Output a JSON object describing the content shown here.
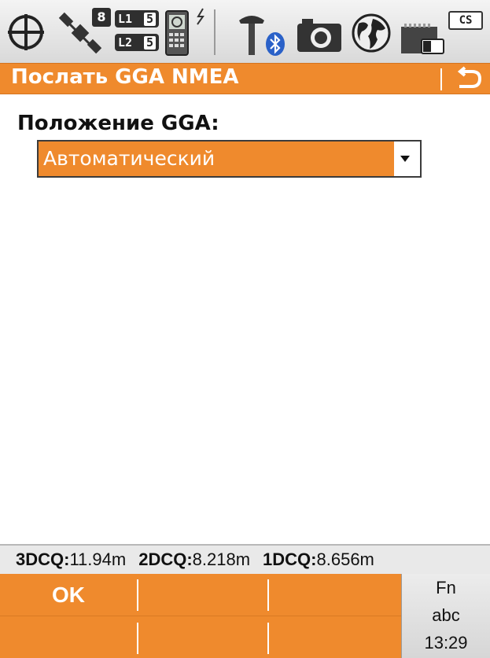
{
  "status_bar": {
    "icons": [
      "crosshair-icon",
      "satellite-icon",
      "l1-l2-icon",
      "phone-icon",
      "lightning-icon",
      "antenna-icon",
      "bluetooth-icon",
      "camera-icon",
      "globe-icon",
      "battery-icon"
    ],
    "satellites": "8",
    "l1_label": "L1",
    "l1_count": "5",
    "l2_label": "L2",
    "l2_count": "5",
    "cs_badge": "CS"
  },
  "title_bar": {
    "title": "Послать GGA NMEA",
    "back_icon": "back-arrow-icon"
  },
  "form": {
    "label": "Положение GGA:",
    "dropdown_value": "Автоматический",
    "dropdown_icon": "dropdown-arrow-icon"
  },
  "quality": {
    "q3_label": "3DCQ:",
    "q3_value": "11.94m",
    "q2_label": "2DCQ:",
    "q2_value": "8.218m",
    "q1_label": "1DCQ:",
    "q1_value": "8.656m"
  },
  "softkeys": {
    "f1": "OK",
    "f2": "",
    "f3": "",
    "f4": "",
    "f5": "",
    "f6": ""
  },
  "fn_panel": {
    "fn": "Fn",
    "input_mode": "abc",
    "time": "13:29"
  },
  "colors": {
    "accent": "#ef8a2d",
    "text": "#111111",
    "background": "#ffffff"
  }
}
